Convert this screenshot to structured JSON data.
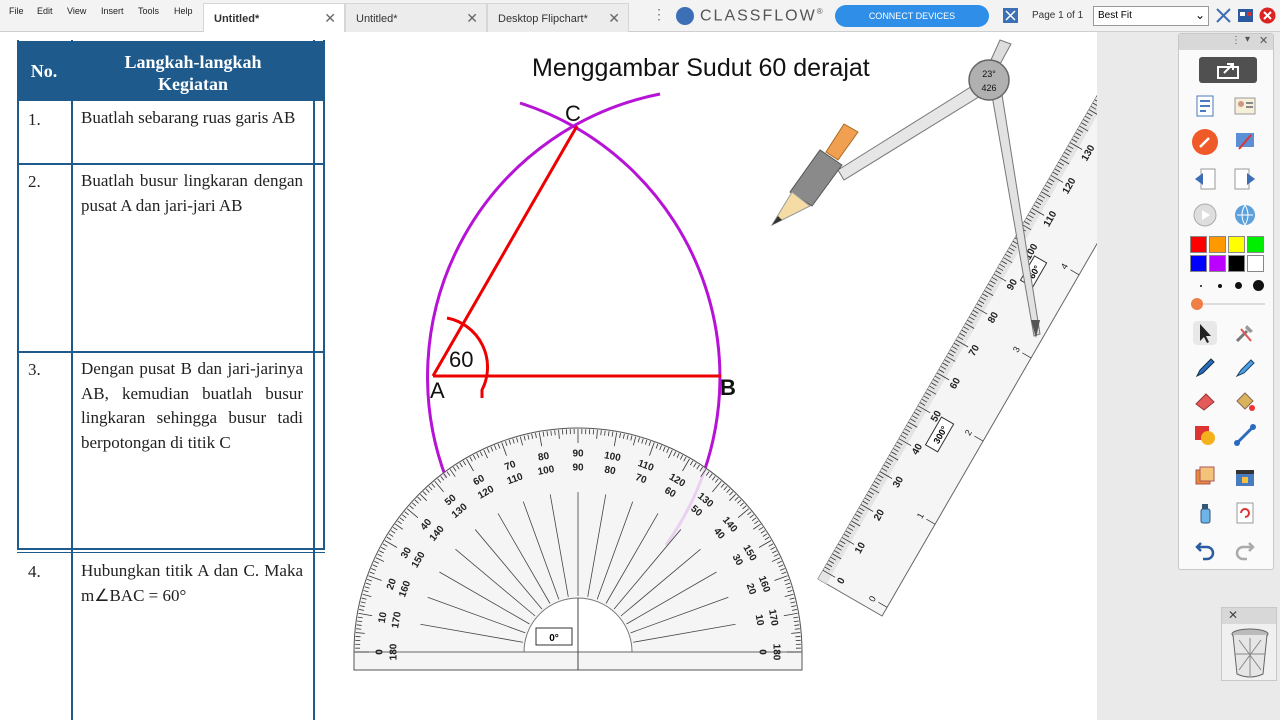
{
  "menu": [
    "File",
    "Edit",
    "View",
    "Insert",
    "Tools",
    "Help"
  ],
  "tabs": [
    {
      "label": "Untitled*",
      "active": true
    },
    {
      "label": "Untitled*",
      "active": false
    },
    {
      "label": "Desktop Flipchart*",
      "active": false
    }
  ],
  "brand": "CLASSFLOW",
  "brand_mark": "®",
  "connect_label": "CONNECT DEVICES",
  "page_label": "Page 1 of 1",
  "zoom": "Best Fit",
  "table": {
    "header_no": "No.",
    "header_steps_line1": "Langkah-langkah",
    "header_steps_line2": "Kegiatan",
    "rows": [
      {
        "no": "1.",
        "text": "Buatlah sebarang ruas garis AB"
      },
      {
        "no": "2.",
        "text": "Buatlah busur lingkaran dengan pusat A dan jari-jari AB"
      },
      {
        "no": "3.",
        "text": "Dengan pusat B dan jari-jarinya AB, kemudian buatlah busur lingkaran sehingga busur tadi berpotongan di titik C"
      },
      {
        "no": "4.",
        "text": "Hubungkan titik A dan C. Maka m∠BAC = 60°"
      }
    ]
  },
  "canvas": {
    "title": "Menggambar Sudut 60 derajat",
    "point_a": "A",
    "point_b": "B",
    "point_c": "C",
    "angle_label": "60",
    "protractor_readout": "0°",
    "compass_angle": "23°",
    "compass_width": "426",
    "ruler_angle": "60°",
    "ruler_length": "300°"
  },
  "palette": {
    "colors": [
      "#ff0000",
      "#ff9900",
      "#ffff00",
      "#00ee00",
      "#0000ff",
      "#bb00ff",
      "#000000",
      "#ffffff"
    ],
    "pen_size": 0.05
  }
}
